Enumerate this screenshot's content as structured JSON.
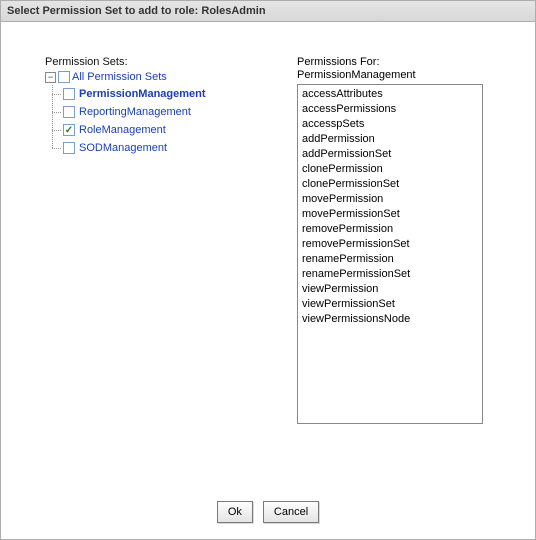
{
  "title": "Select Permission Set to add to role: RolesAdmin",
  "left_label": "Permission Sets:",
  "tree": {
    "root_label": "All Permission Sets",
    "items": [
      {
        "label": "PermissionManagement",
        "checked": false,
        "selected": true
      },
      {
        "label": "ReportingManagement",
        "checked": false,
        "selected": false
      },
      {
        "label": "RoleManagement",
        "checked": true,
        "selected": false
      },
      {
        "label": "SODManagement",
        "checked": false,
        "selected": false
      }
    ]
  },
  "right_label": "Permissions For:",
  "right_source": "PermissionManagement",
  "permissions": [
    "accessAttributes",
    "accessPermissions",
    "accesspSets",
    "addPermission",
    "addPermissionSet",
    "clonePermission",
    "clonePermissionSet",
    "movePermission",
    "movePermissionSet",
    "removePermission",
    "removePermissionSet",
    "renamePermission",
    "renamePermissionSet",
    "viewPermission",
    "viewPermissionSet",
    "viewPermissionsNode"
  ],
  "buttons": {
    "ok": "Ok",
    "cancel": "Cancel"
  }
}
